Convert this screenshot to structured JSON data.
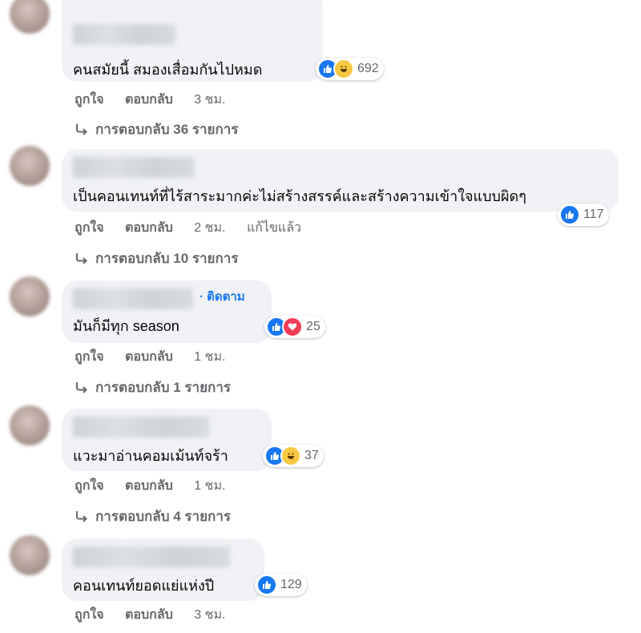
{
  "comments": [
    {
      "text": "คนสมัยนี้ สมองเสื่อมกันไปหมด",
      "reaction_icons": [
        "like-icon",
        "haha-icon"
      ],
      "reaction_count": "692",
      "like_label": "ถูกใจ",
      "reply_label": "ตอบกลับ",
      "time": "3 ชม.",
      "replies": "การตอบกลับ 36 รายการ"
    },
    {
      "text": "เป็นคอนเทนท์ที่ไร้สาระมากค่ะไม่สร้างสรรค์และสร้างความเข้าใจแบบผิดๆ",
      "reaction_icons": [
        "like-icon"
      ],
      "reaction_count": "117",
      "like_label": "ถูกใจ",
      "reply_label": "ตอบกลับ",
      "time": "2 ชม.",
      "edited": "แก้ไขแล้ว",
      "replies": "การตอบกลับ 10 รายการ"
    },
    {
      "follow": "· ติดตาม",
      "text": "มันก็มีทุก season",
      "reaction_icons": [
        "like-icon",
        "love-icon"
      ],
      "reaction_count": "25",
      "like_label": "ถูกใจ",
      "reply_label": "ตอบกลับ",
      "time": "1 ชม.",
      "replies": "การตอบกลับ 1 รายการ"
    },
    {
      "text": "แวะมาอ่านคอมเม้นท์จร้า",
      "reaction_icons": [
        "like-icon",
        "haha-icon"
      ],
      "reaction_count": "37",
      "like_label": "ถูกใจ",
      "reply_label": "ตอบกลับ",
      "time": "1 ชม.",
      "replies": "การตอบกลับ 4 รายการ"
    },
    {
      "text": "คอนเทนท์ยอดแย่แห่งปี",
      "reaction_icons": [
        "like-icon"
      ],
      "reaction_count": "129",
      "like_label": "ถูกใจ",
      "reply_label": "ตอบกลับ",
      "time": "3 ชม."
    }
  ],
  "colors": {
    "bubble": "#f0f2f5",
    "secondary_text": "#65676b",
    "link_blue": "#1877f2",
    "like": "#1877f2",
    "haha": "#f7c843",
    "love": "#f33e58"
  }
}
